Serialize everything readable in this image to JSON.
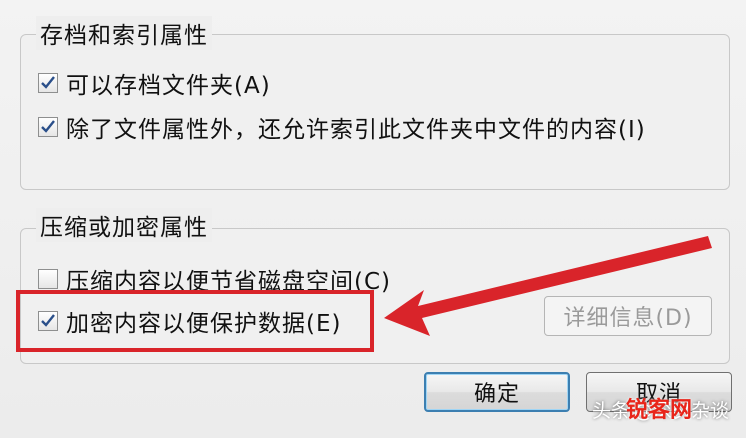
{
  "archive_group": {
    "title": "存档和索引属性",
    "options": [
      {
        "label": "可以存档文件夹(A)",
        "checked": true
      },
      {
        "label": "除了文件属性外，还允许索引此文件夹中文件的内容(I)",
        "checked": true
      }
    ]
  },
  "compress_group": {
    "title": "压缩或加密属性",
    "options": [
      {
        "label": "压缩内容以便节省磁盘空间(C)",
        "checked": false
      },
      {
        "label": "加密内容以便保护数据(E)",
        "checked": true
      }
    ],
    "details_label": "详细信息(D)"
  },
  "footer": {
    "ok_label": "确定",
    "cancel_label": "取消"
  },
  "annotation": {
    "highlight_color": "#d9242a"
  },
  "watermark": {
    "prefix": "头条",
    "author": "@深夕杂谈",
    "brand": "锐客网"
  }
}
